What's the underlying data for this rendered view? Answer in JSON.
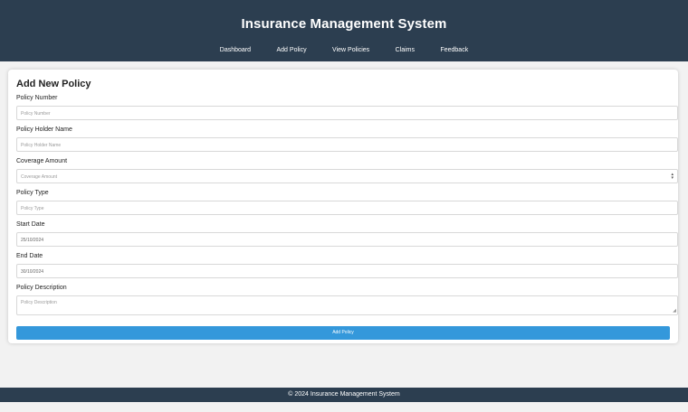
{
  "header": {
    "title": "Insurance Management System",
    "nav": [
      "Dashboard",
      "Add Policy",
      "View Policies",
      "Claims",
      "Feedback"
    ]
  },
  "form": {
    "title": "Add New Policy",
    "fields": [
      {
        "label": "Policy Number",
        "placeholder": "Policy Number"
      },
      {
        "label": "Policy Holder Name",
        "placeholder": "Policy Holder Name"
      },
      {
        "label": "Coverage Amount",
        "placeholder": "Coverage Amount"
      },
      {
        "label": "Policy Type",
        "placeholder": "Policy Type"
      },
      {
        "label": "Start Date",
        "value": "25/10/2024"
      },
      {
        "label": "End Date",
        "value": "30/10/2024"
      },
      {
        "label": "Policy Description",
        "placeholder": "Policy Description"
      }
    ],
    "submit_label": "Add Policy"
  },
  "footer": {
    "text": "© 2024 Insurance Management System"
  },
  "colors": {
    "header_bg": "#2c3e50",
    "button_bg": "#3498db",
    "page_bg": "#f2f2f2"
  }
}
